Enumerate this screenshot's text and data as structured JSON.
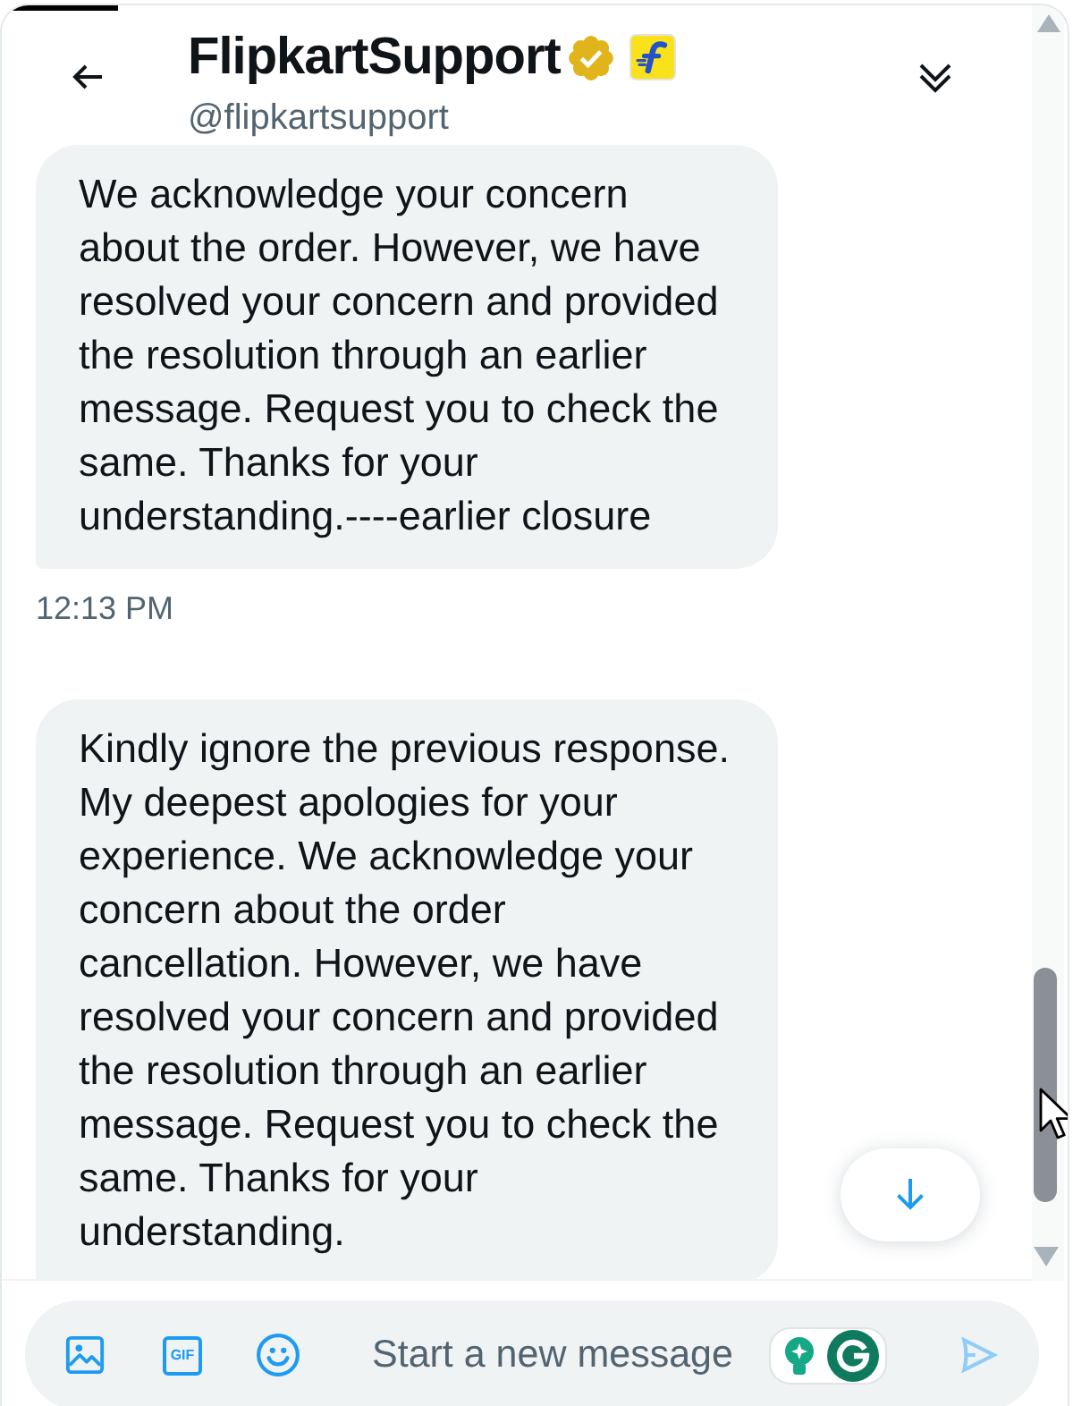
{
  "header": {
    "name": "FlipkartSupport",
    "verified": true,
    "handle": "@flipkartsupport"
  },
  "messages": [
    {
      "text": "We acknowledge your concern about the order. However, we have resolved your concern and provided the resolution through an earlier message. Request you to check the same. Thanks for your understanding.----earlier closure",
      "time": "12:13 PM"
    },
    {
      "text": "Kindly ignore the previous response. My deepest apologies for your experience. We acknowledge your concern about the order cancellation. However, we have resolved your concern and provided the resolution through an earlier message. Request you to check the same. Thanks for your understanding."
    }
  ],
  "composer": {
    "gif_label": "GIF",
    "placeholder": "Start a new message",
    "send_disabled": true
  }
}
